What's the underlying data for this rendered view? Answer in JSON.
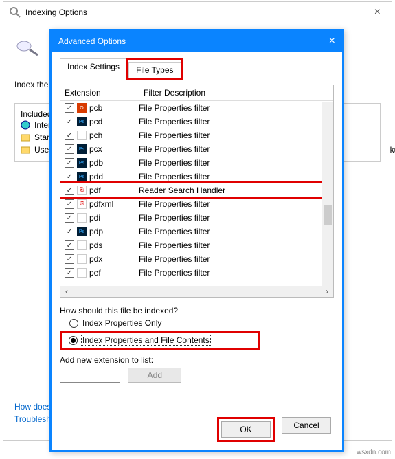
{
  "parent": {
    "title": "Indexing Options",
    "index_the_label": "Index the",
    "included_legend": "Included",
    "kups_col": "kups",
    "locations": [
      {
        "icon": "ie",
        "label": "Inter"
      },
      {
        "icon": "folder",
        "label": "Star"
      },
      {
        "icon": "folder",
        "label": "User"
      }
    ],
    "links": {
      "how_does": "How does",
      "troublesh": "Troublesh"
    }
  },
  "adv": {
    "title": "Advanced Options",
    "tabs": {
      "index_settings": "Index Settings",
      "file_types": "File Types"
    },
    "columns": {
      "extension": "Extension",
      "filter_desc": "Filter Description"
    },
    "rows": [
      {
        "icon": "o",
        "ext": "pcb",
        "desc": "File Properties filter"
      },
      {
        "icon": "ps",
        "ext": "pcd",
        "desc": "File Properties filter"
      },
      {
        "icon": "blank",
        "ext": "pch",
        "desc": "File Properties filter"
      },
      {
        "icon": "ps",
        "ext": "pcx",
        "desc": "File Properties filter"
      },
      {
        "icon": "ps",
        "ext": "pdb",
        "desc": "File Properties filter"
      },
      {
        "icon": "ps",
        "ext": "pdd",
        "desc": "File Properties filter"
      },
      {
        "icon": "pdf",
        "ext": "pdf",
        "desc": "Reader Search Handler",
        "highlight": true
      },
      {
        "icon": "pdf",
        "ext": "pdfxml",
        "desc": "File Properties filter"
      },
      {
        "icon": "blank",
        "ext": "pdi",
        "desc": "File Properties filter"
      },
      {
        "icon": "ps",
        "ext": "pdp",
        "desc": "File Properties filter"
      },
      {
        "icon": "blank",
        "ext": "pds",
        "desc": "File Properties filter"
      },
      {
        "icon": "blank",
        "ext": "pdx",
        "desc": "File Properties filter"
      },
      {
        "icon": "blank",
        "ext": "pef",
        "desc": "File Properties filter"
      }
    ],
    "radio": {
      "question": "How should this file be indexed?",
      "opt1": "Index Properties Only",
      "opt2": "Index Properties and File Contents",
      "selected": 2
    },
    "add_ext": {
      "label": "Add new extension to list:",
      "value": "",
      "button": "Add"
    },
    "buttons": {
      "ok": "OK",
      "cancel": "Cancel",
      "close": "Close"
    }
  },
  "watermark": "wsxdn.com"
}
